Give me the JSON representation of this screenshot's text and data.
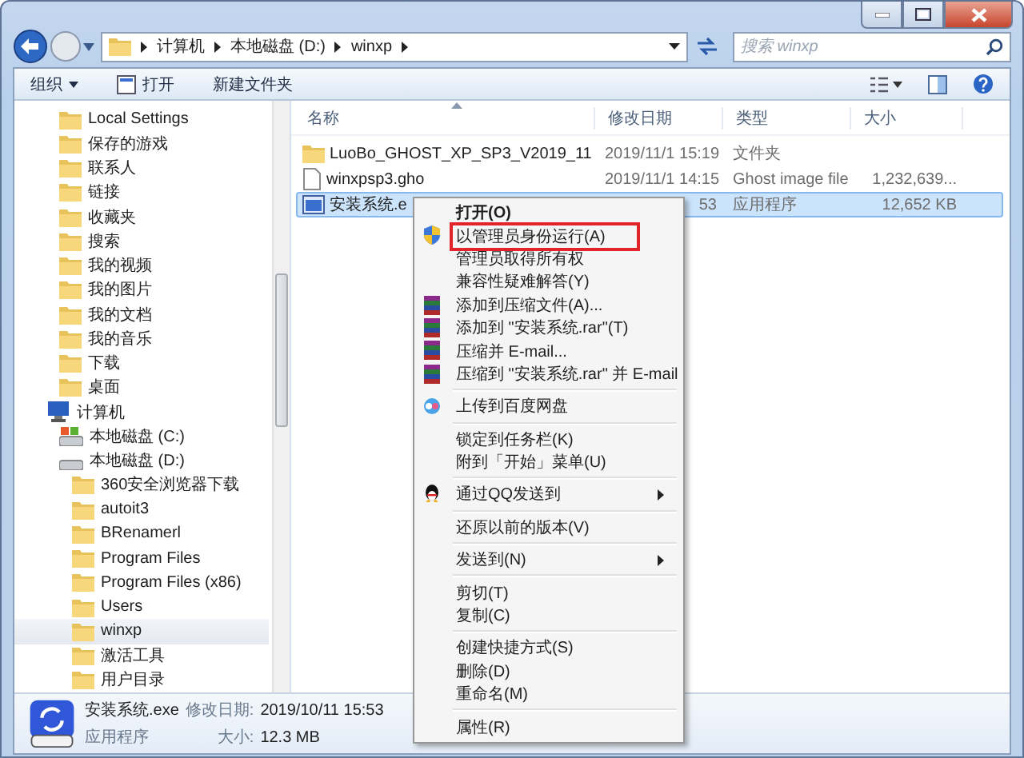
{
  "address": {
    "crumbs": [
      "计算机",
      "本地磁盘 (D:)",
      "winxp"
    ]
  },
  "search": {
    "placeholder": "搜索 winxp"
  },
  "toolbar": {
    "organize": "组织",
    "open": "打开",
    "new_folder": "新建文件夹"
  },
  "nav": {
    "user_items": [
      {
        "label": "Local Settings",
        "selected": false
      },
      {
        "label": "保存的游戏",
        "selected": false
      },
      {
        "label": "联系人",
        "selected": false
      },
      {
        "label": "链接",
        "selected": false
      },
      {
        "label": "收藏夹",
        "selected": false
      },
      {
        "label": "搜索",
        "selected": false
      },
      {
        "label": "我的视频",
        "selected": false
      },
      {
        "label": "我的图片",
        "selected": false
      },
      {
        "label": "我的文档",
        "selected": false
      },
      {
        "label": "我的音乐",
        "selected": false
      },
      {
        "label": "下载",
        "selected": false
      },
      {
        "label": "桌面",
        "selected": false
      }
    ],
    "tree": [
      {
        "label": "计算机",
        "kind": "computer",
        "selected": false,
        "children": [
          {
            "label": "本地磁盘 (C:)",
            "kind": "system-drive",
            "selected": false
          },
          {
            "label": "本地磁盘 (D:)",
            "kind": "drive",
            "selected": false,
            "children": [
              {
                "label": "360安全浏览器下载",
                "kind": "folder",
                "selected": false
              },
              {
                "label": "autoit3",
                "kind": "folder",
                "selected": false
              },
              {
                "label": "BRenamerl",
                "kind": "folder",
                "selected": false
              },
              {
                "label": "Program Files",
                "kind": "folder",
                "selected": false
              },
              {
                "label": "Program Files (x86)",
                "kind": "folder",
                "selected": false
              },
              {
                "label": "Users",
                "kind": "folder",
                "selected": false
              },
              {
                "label": "winxp",
                "kind": "folder",
                "selected": true
              },
              {
                "label": "激活工具",
                "kind": "folder",
                "selected": false
              },
              {
                "label": "用户目录",
                "kind": "folder",
                "selected": false
              }
            ]
          }
        ]
      }
    ]
  },
  "files": {
    "columns": [
      "名称",
      "修改日期",
      "类型",
      "大小"
    ],
    "rows": [
      {
        "kind": "folder",
        "name": "LuoBo_GHOST_XP_SP3_V2019_11",
        "date": "2019/11/1 15:19",
        "type": "文件夹",
        "size": "",
        "selected": false
      },
      {
        "kind": "file",
        "name": "winxpsp3.gho",
        "date": "2019/11/1 14:15",
        "type": "Ghost image file",
        "size": "1,232,639...",
        "selected": false
      },
      {
        "kind": "exe",
        "name": "安装系统.e",
        "date": "53",
        "type": "应用程序",
        "size": "12,652 KB",
        "selected": true
      }
    ]
  },
  "menu": {
    "groups": [
      [
        {
          "label": "打开(O)",
          "kind": "plain",
          "bold": true,
          "outlined": false,
          "submenu": false
        },
        {
          "label": "以管理员身份运行(A)",
          "kind": "shield",
          "bold": false,
          "outlined": true,
          "submenu": false
        },
        {
          "label": "管理员取得所有权",
          "kind": "plain",
          "bold": false,
          "outlined": false,
          "submenu": false
        },
        {
          "label": "兼容性疑难解答(Y)",
          "kind": "plain",
          "bold": false,
          "outlined": false,
          "submenu": false
        },
        {
          "label": "添加到压缩文件(A)...",
          "kind": "archive",
          "bold": false,
          "outlined": false,
          "submenu": false
        },
        {
          "label": "添加到 \"安装系统.rar\"(T)",
          "kind": "archive",
          "bold": false,
          "outlined": false,
          "submenu": false
        },
        {
          "label": "压缩并 E-mail...",
          "kind": "archive",
          "bold": false,
          "outlined": false,
          "submenu": false
        },
        {
          "label": "压缩到 \"安装系统.rar\" 并 E-mail",
          "kind": "archive",
          "bold": false,
          "outlined": false,
          "submenu": false
        }
      ],
      [
        {
          "label": "上传到百度网盘",
          "kind": "cloud",
          "bold": false,
          "outlined": false,
          "submenu": false
        }
      ],
      [
        {
          "label": "锁定到任务栏(K)",
          "kind": "plain",
          "bold": false,
          "outlined": false,
          "submenu": false
        },
        {
          "label": "附到「开始」菜单(U)",
          "kind": "plain",
          "bold": false,
          "outlined": false,
          "submenu": false
        }
      ],
      [
        {
          "label": "通过QQ发送到",
          "kind": "qq",
          "bold": false,
          "outlined": false,
          "submenu": true
        }
      ],
      [
        {
          "label": "还原以前的版本(V)",
          "kind": "plain",
          "bold": false,
          "outlined": false,
          "submenu": false
        }
      ],
      [
        {
          "label": "发送到(N)",
          "kind": "plain",
          "bold": false,
          "outlined": false,
          "submenu": true
        }
      ],
      [
        {
          "label": "剪切(T)",
          "kind": "plain",
          "bold": false,
          "outlined": false,
          "submenu": false
        },
        {
          "label": "复制(C)",
          "kind": "plain",
          "bold": false,
          "outlined": false,
          "submenu": false
        }
      ],
      [
        {
          "label": "创建快捷方式(S)",
          "kind": "plain",
          "bold": false,
          "outlined": false,
          "submenu": false
        },
        {
          "label": "删除(D)",
          "kind": "plain",
          "bold": false,
          "outlined": false,
          "submenu": false
        },
        {
          "label": "重命名(M)",
          "kind": "plain",
          "bold": false,
          "outlined": false,
          "submenu": false
        }
      ],
      [
        {
          "label": "属性(R)",
          "kind": "plain",
          "bold": false,
          "outlined": false,
          "submenu": false
        }
      ]
    ]
  },
  "details": {
    "name": "安装系统.exe",
    "date_label": "修改日期:",
    "date": "2019/10/11 15:53",
    "type": "应用程序",
    "size_label": "大小:",
    "size": "12.3 MB"
  }
}
